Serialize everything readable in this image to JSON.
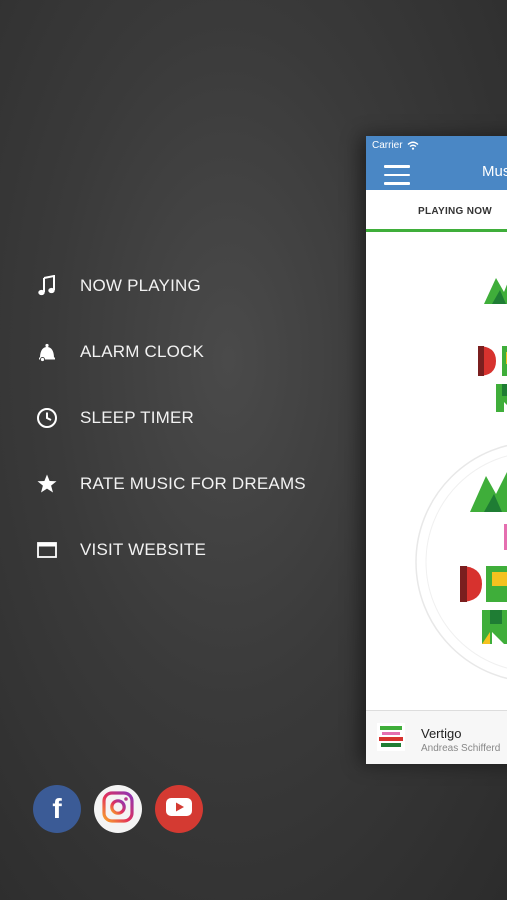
{
  "menu": {
    "items": [
      {
        "label": "NOW PLAYING",
        "icon": "music-note-icon"
      },
      {
        "label": "ALARM CLOCK",
        "icon": "bell-icon"
      },
      {
        "label": "SLEEP TIMER",
        "icon": "clock-icon"
      },
      {
        "label": "RATE MUSIC FOR DREAMS",
        "icon": "star-icon"
      },
      {
        "label": "VISIT WEBSITE",
        "icon": "browser-window-icon"
      }
    ]
  },
  "social": {
    "items": [
      {
        "name": "facebook",
        "glyph": "f",
        "color": "#3b5b96"
      },
      {
        "name": "instagram",
        "color": "#f4f4f4"
      },
      {
        "name": "youtube",
        "color": "#d43a32"
      }
    ]
  },
  "app": {
    "status_carrier": "Carrier",
    "nav_title": "Mus",
    "tab_label": "PLAYING NOW",
    "accent_color": "#4a87c5",
    "tab_indicator_color": "#3fae3a",
    "now_playing": {
      "title": "Vertigo",
      "artist": "Andreas Schifferd",
      "thumb_text": "MUSIC FOR DREAMS RADIO"
    }
  }
}
